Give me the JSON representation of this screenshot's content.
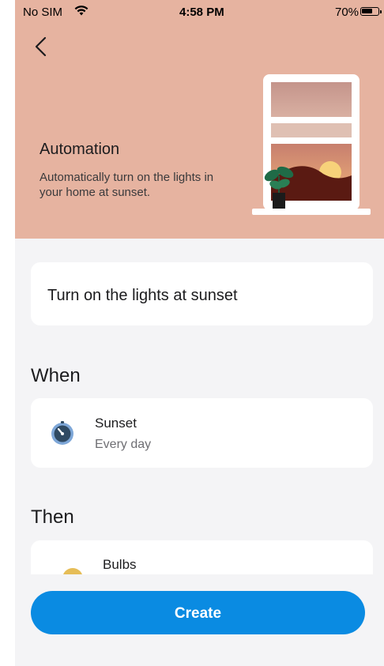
{
  "status_bar": {
    "carrier": "No SIM",
    "time": "4:58 PM",
    "battery_percent": "70%",
    "battery_level": 0.7,
    "wifi_icon": "wifi-icon",
    "battery_icon": "battery-icon"
  },
  "hero": {
    "title": "Automation",
    "description": "Automatically turn on the lights in your home at sunset.",
    "background_color": "#e6b3a0",
    "back_icon": "chevron-left-icon",
    "illustration": "window-sunset-illustration"
  },
  "automation_name": "Turn on the lights at sunset",
  "when": {
    "section_title": "When",
    "trigger": {
      "title": "Sunset",
      "subtitle": "Every day",
      "icon": "timer-icon"
    }
  },
  "then": {
    "section_title": "Then",
    "action": {
      "title": "Bulbs",
      "icon": "bulb-icon"
    }
  },
  "create_button": {
    "label": "Create",
    "color": "#0a8be2"
  }
}
